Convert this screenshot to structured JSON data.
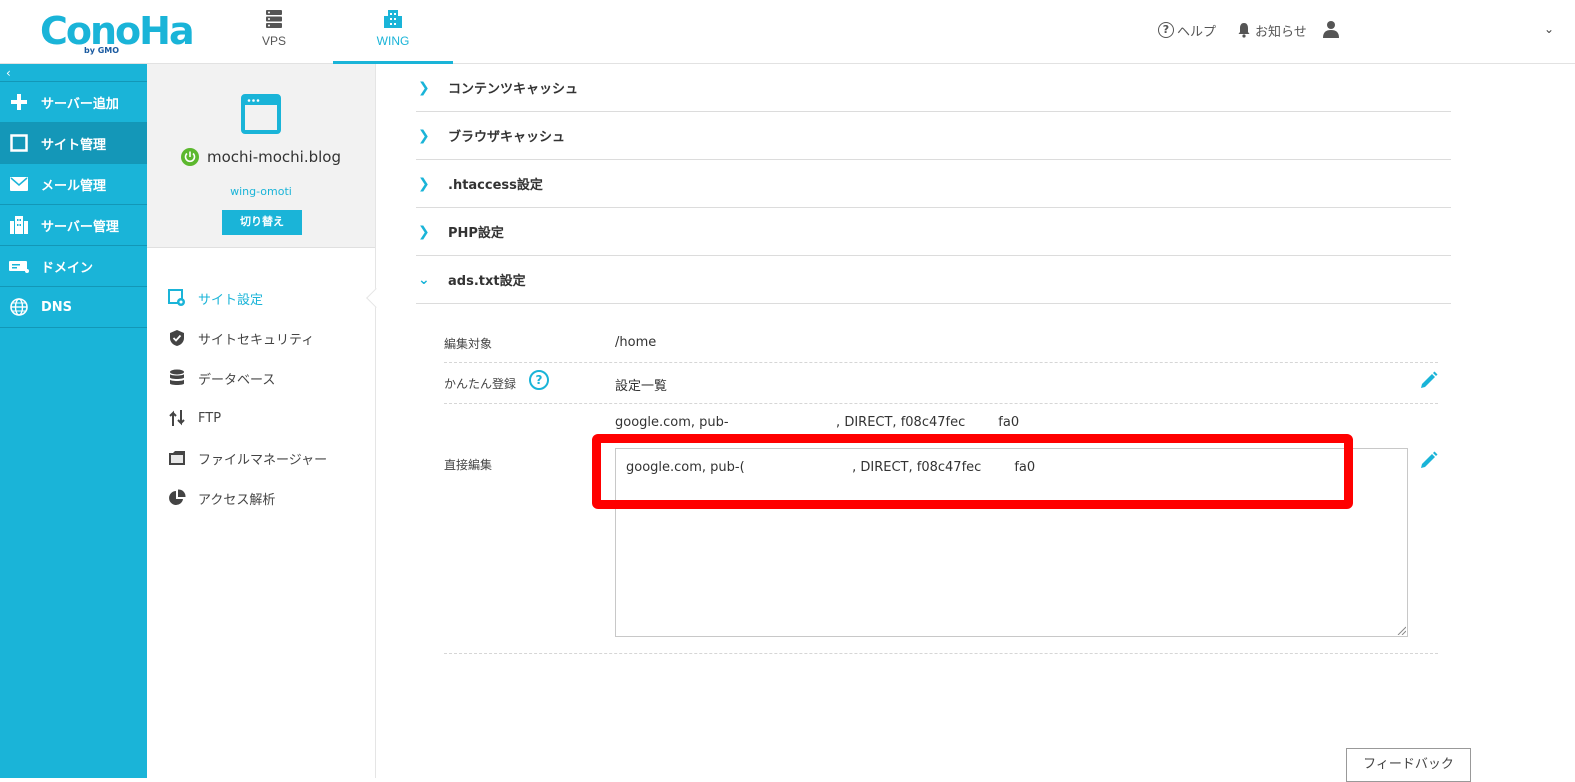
{
  "header": {
    "logo_text": "ConoHa",
    "logo_sub": "by GMO",
    "tabs": [
      {
        "label": "VPS",
        "icon": "server-icon"
      },
      {
        "label": "WING",
        "icon": "building-icon",
        "active": true
      }
    ],
    "help_label": "ヘルプ",
    "notice_label": "お知らせ",
    "help_glyph": "?",
    "caret": "⌄"
  },
  "sidebar": {
    "collapse_glyph": "‹",
    "items": [
      {
        "label": "サーバー追加",
        "icon": "plus-icon"
      },
      {
        "label": "サイト管理",
        "icon": "window-icon",
        "active": true
      },
      {
        "label": "メール管理",
        "icon": "mail-icon"
      },
      {
        "label": "サーバー管理",
        "icon": "building-icon"
      },
      {
        "label": "ドメイン",
        "icon": "domain-icon"
      },
      {
        "label": "DNS",
        "icon": "globe-icon"
      }
    ]
  },
  "site": {
    "name": "mochi-mochi.blog",
    "account": "wing-omoti",
    "switch_label": "切り替え",
    "menu": [
      {
        "label": "サイト設定",
        "icon": "site-settings-icon",
        "active": true
      },
      {
        "label": "サイトセキュリティ",
        "icon": "shield-icon"
      },
      {
        "label": "データベース",
        "icon": "database-icon"
      },
      {
        "label": "FTP",
        "icon": "transfer-icon"
      },
      {
        "label": "ファイルマネージャー",
        "icon": "folder-icon"
      },
      {
        "label": "アクセス解析",
        "icon": "pie-chart-icon"
      }
    ]
  },
  "accordion": [
    {
      "label": "コンテンツキャッシュ",
      "expanded": false
    },
    {
      "label": "ブラウザキャッシュ",
      "expanded": false
    },
    {
      "label": ".htaccess設定",
      "expanded": false
    },
    {
      "label": "PHP設定",
      "expanded": false
    },
    {
      "label": "ads.txt設定",
      "expanded": true
    }
  ],
  "chevrons": {
    "collapsed": "❯",
    "expanded": "⌄"
  },
  "ads_txt": {
    "target_label": "編集対象",
    "target_value": "/home",
    "easy_label": "かんたん登録",
    "easy_value": "設定一覧",
    "help_glyph": "?",
    "entry_line": "google.com, pub-                          , DIRECT, f08c47fec        fa0",
    "direct_label": "直接編集",
    "textarea_value": "google.com, pub-(                          , DIRECT, f08c47fec        fa0"
  },
  "feedback_label": "フィードバック",
  "colors": {
    "accent": "#1ab4d8",
    "highlight": "#ff0000",
    "power": "#5cb82e"
  }
}
